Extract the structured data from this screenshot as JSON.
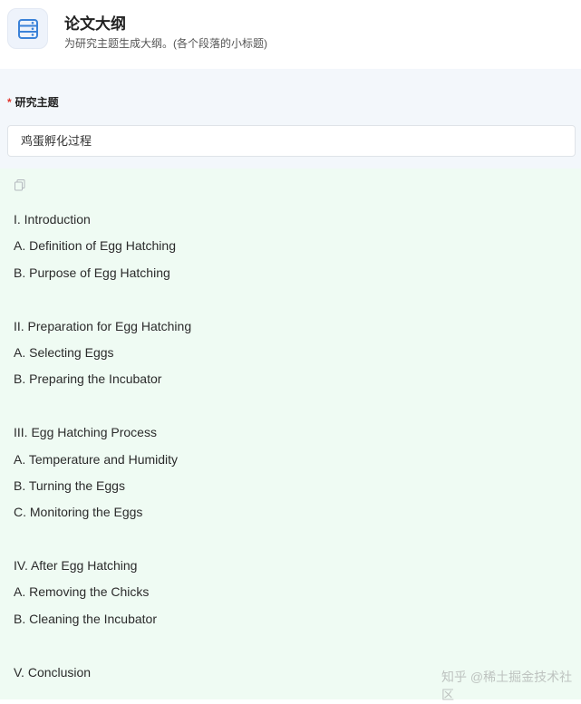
{
  "header": {
    "icon": "document-list-icon",
    "title": "论文大纲",
    "subtitle": "为研究主题生成大纲。(各个段落的小标题)"
  },
  "form": {
    "required_mark": "*",
    "label": "研究主题",
    "value": "鸡蛋孵化过程"
  },
  "result": {
    "copy_icon": "copy-icon",
    "outline": [
      {
        "heading": "I. Introduction",
        "items": [
          "A. Definition of Egg Hatching",
          "B. Purpose of Egg Hatching"
        ]
      },
      {
        "heading": "II. Preparation for Egg Hatching",
        "items": [
          "A. Selecting Eggs",
          "B. Preparing the Incubator"
        ]
      },
      {
        "heading": "III. Egg Hatching Process",
        "items": [
          "A. Temperature and Humidity",
          "B. Turning the Eggs",
          "C. Monitoring the Eggs"
        ]
      },
      {
        "heading": "IV. After Egg Hatching",
        "items": [
          "A. Removing the Chicks",
          "B. Cleaning the Incubator"
        ]
      },
      {
        "heading": "V. Conclusion",
        "items": []
      }
    ]
  },
  "watermark": "知乎 @稀土掘金技术社区",
  "colors": {
    "accent": "#3b82d8",
    "result_bg": "#effbf3",
    "form_bg": "#f3f7fb",
    "required": "#e0342c"
  }
}
